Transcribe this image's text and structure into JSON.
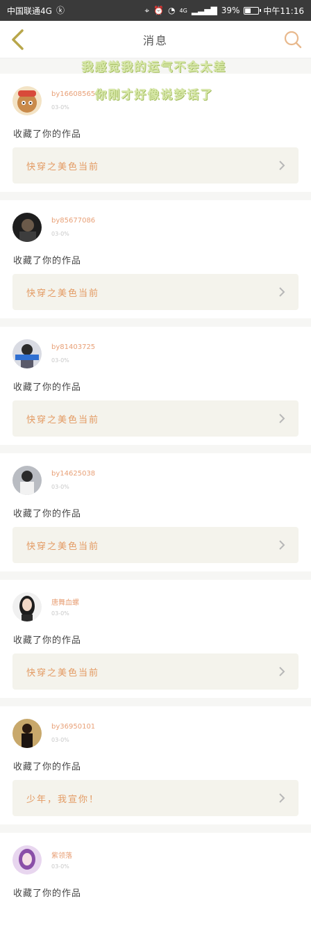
{
  "status_bar": {
    "carrier": "中国联通4G",
    "network_badge": "4G",
    "battery": "39%",
    "time": "中午11:16",
    "icons": [
      "carrier-k-icon",
      "location-icon",
      "alarm-icon",
      "wifi-icon",
      "signal-icon",
      "battery-icon"
    ]
  },
  "header": {
    "title": "消息",
    "back_icon": "back-chevron-icon",
    "search_icon": "search-icon",
    "accent_color": "#e8b88c"
  },
  "overlay": {
    "line1": "我感觉我的运气不会太差",
    "line2": "你刚才好像说梦话了"
  },
  "messages": [
    {
      "user": "by16608565",
      "time": "03-0%",
      "action": "收藏了你的作品",
      "work": "快穿之美色当前"
    },
    {
      "user": "by85677086",
      "time": "03-0%",
      "action": "收藏了你的作品",
      "work": "快穿之美色当前"
    },
    {
      "user": "by81403725",
      "time": "03-0%",
      "action": "收藏了你的作品",
      "work": "快穿之美色当前"
    },
    {
      "user": "by14625038",
      "time": "03-0%",
      "action": "收藏了你的作品",
      "work": "快穿之美色当前"
    },
    {
      "user": "唐舞血螺",
      "time": "03-0%",
      "action": "收藏了你的作品",
      "work": "快穿之美色当前"
    },
    {
      "user": "by36950101",
      "time": "03-0%",
      "action": "收藏了你的作品",
      "work": "少年，我宣你！"
    },
    {
      "user": "紫领落",
      "time": "03-0%",
      "action": "收藏了你的作品",
      "work": ""
    }
  ],
  "colors": {
    "username": "#e8a077",
    "work_title": "#e39a62",
    "work_bg": "#f4f3ec",
    "back_icon": "#b8a64a"
  }
}
